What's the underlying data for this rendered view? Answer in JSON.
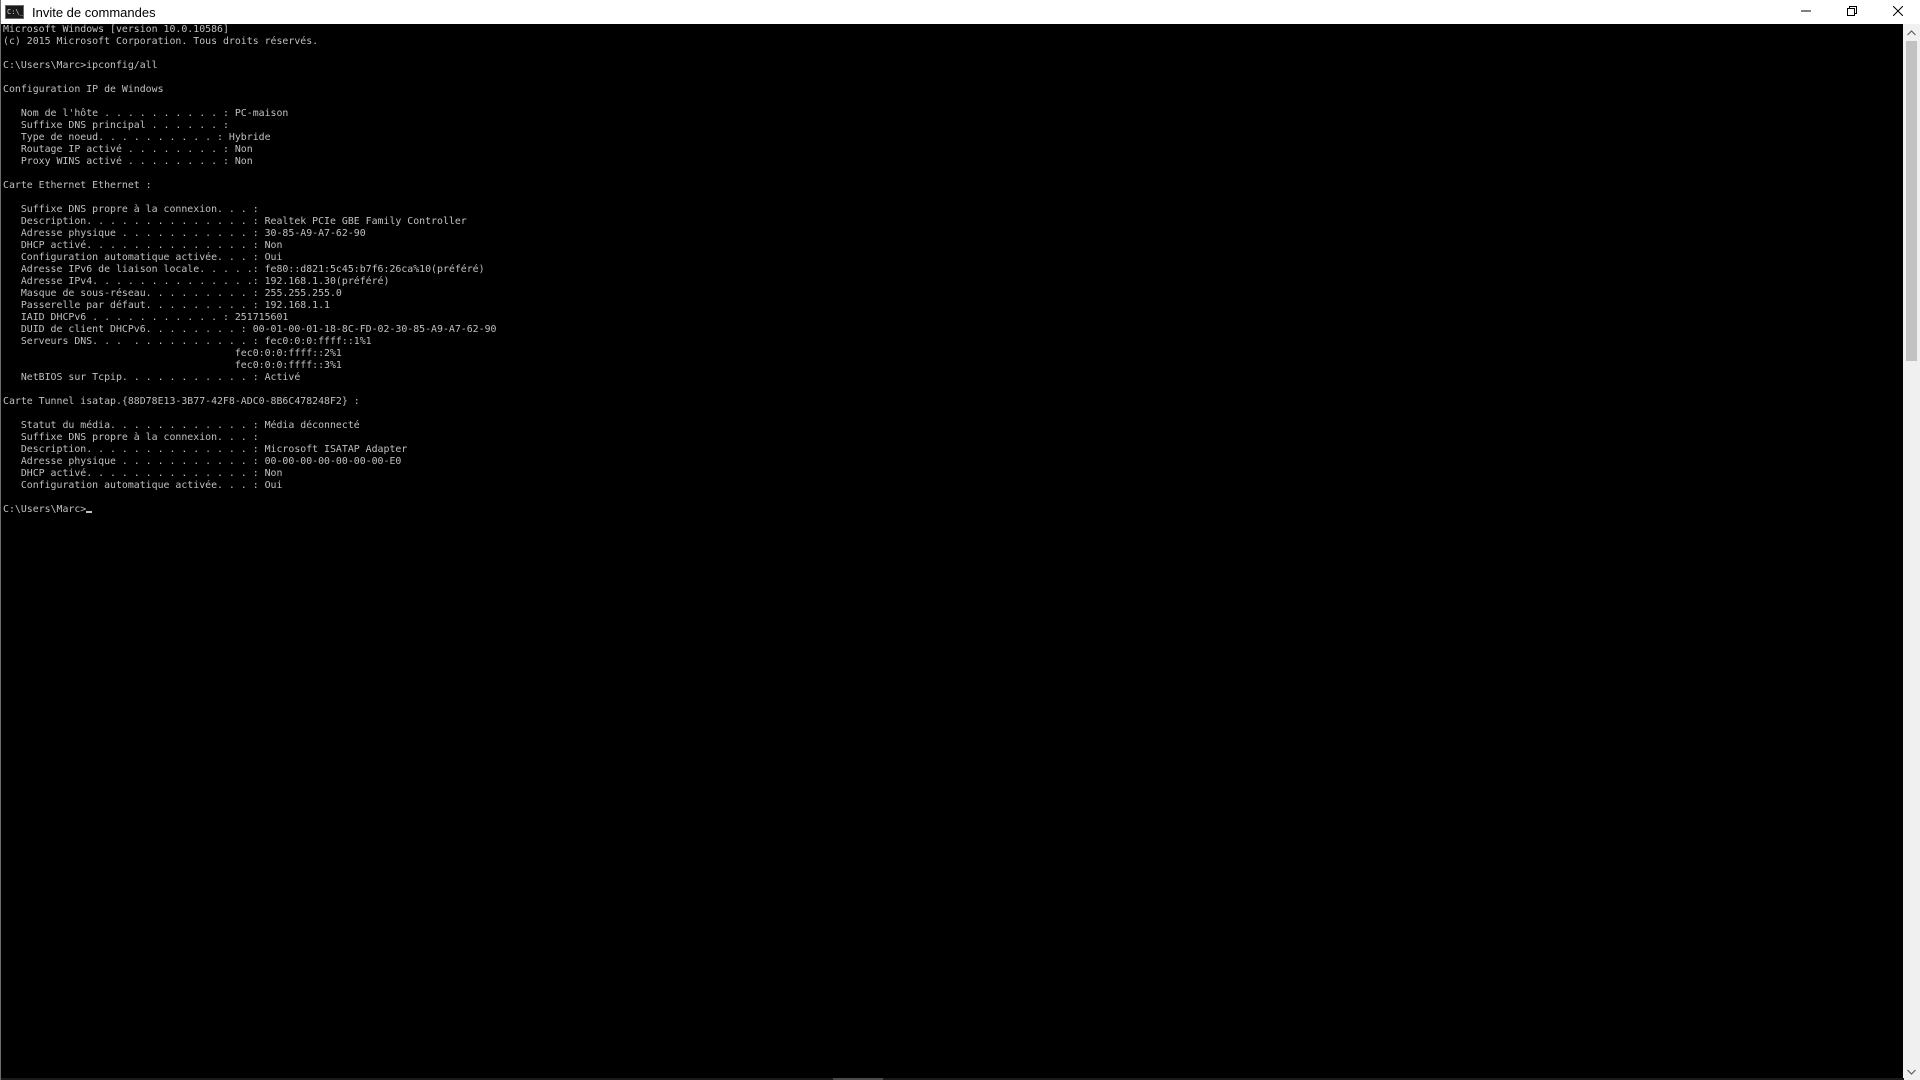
{
  "window": {
    "title": "Invite de commandes",
    "icon_text": "C:\\_",
    "controls": {
      "minimize": "minimize-icon",
      "restore": "restore-icon",
      "close": "close-icon"
    }
  },
  "console": {
    "background": "#000000",
    "foreground": "#c0c0c0",
    "lines": [
      "Microsoft Windows [version 10.0.10586]",
      "(c) 2015 Microsoft Corporation. Tous droits réservés.",
      "",
      "C:\\Users\\Marc>ipconfig/all",
      "",
      "Configuration IP de Windows",
      "",
      "   Nom de l'hôte . . . . . . . . . . : PC-maison",
      "   Suffixe DNS principal . . . . . . :",
      "   Type de noeud. . . . . . . . . . : Hybride",
      "   Routage IP activé . . . . . . . . : Non",
      "   Proxy WINS activé . . . . . . . . : Non",
      "",
      "Carte Ethernet Ethernet :",
      "",
      "   Suffixe DNS propre à la connexion. . . :",
      "   Description. . . . . . . . . . . . . . : Realtek PCIe GBE Family Controller",
      "   Adresse physique . . . . . . . . . . . : 30-85-A9-A7-62-90",
      "   DHCP activé. . . . . . . . . . . . . . : Non",
      "   Configuration automatique activée. . . : Oui",
      "   Adresse IPv6 de liaison locale. . . . .: fe80::d821:5c45:b7f6:26ca%10(préféré)",
      "   Adresse IPv4. . . . . . . . . . . . . .: 192.168.1.30(préféré)",
      "   Masque de sous-réseau. . . . . . . . . : 255.255.255.0",
      "   Passerelle par défaut. . . . . . . . . : 192.168.1.1",
      "   IAID DHCPv6 . . . . . . . . . . . : 251715601",
      "   DUID de client DHCPv6. . . . . . . . : 00-01-00-01-18-8C-FD-02-30-85-A9-A7-62-90",
      "   Serveurs DNS. . .  . . . . . . . . . . : fec0:0:0:ffff::1%1",
      "                                       fec0:0:0:ffff::2%1",
      "                                       fec0:0:0:ffff::3%1",
      "   NetBIOS sur Tcpip. . . . . . . . . . . : Activé",
      "",
      "Carte Tunnel isatap.{88D78E13-3B77-42F8-ADC0-8B6C478248F2} :",
      "",
      "   Statut du média. . . . . . . . . . . . : Média déconnecté",
      "   Suffixe DNS propre à la connexion. . . :",
      "   Description. . . . . . . . . . . . . . : Microsoft ISATAP Adapter",
      "   Adresse physique . . . . . . . . . . . : 00-00-00-00-00-00-00-E0",
      "   DHCP activé. . . . . . . . . . . . . . : Non",
      "   Configuration automatique activée. . . : Oui",
      ""
    ],
    "prompt": "C:\\Users\\Marc>"
  },
  "scrollbar": {
    "up_icon": "chevron-up-icon",
    "down_icon": "chevron-down-icon"
  }
}
